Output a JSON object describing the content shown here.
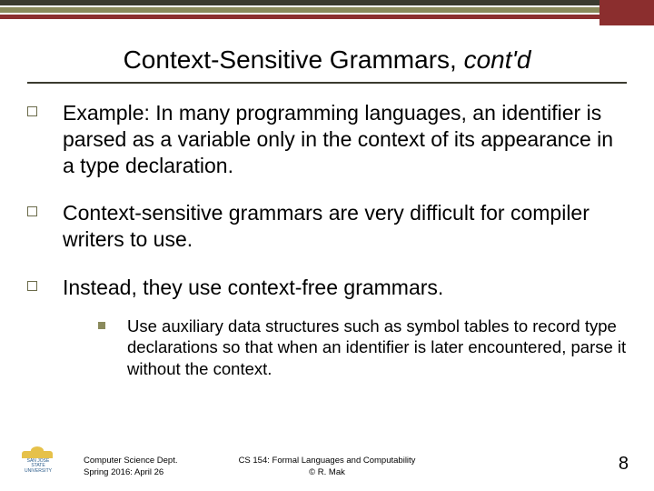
{
  "title": {
    "main": "Context-Sensitive Grammars, ",
    "emph": "cont'd"
  },
  "bullets": [
    {
      "text": "Example: In many programming languages, an identifier is parsed as a variable only in the context of its appearance in a type declaration."
    },
    {
      "text": "Context-sensitive grammars are very difficult for compiler writers to use."
    },
    {
      "text": "Instead, they use context-free grammars.",
      "sub": [
        {
          "text": "Use auxiliary data structures such as symbol tables to record type declarations so that when an identifier is later encountered, parse it without the context."
        }
      ]
    }
  ],
  "footer": {
    "left_line1": "Computer Science Dept.",
    "left_line2": "Spring 2016: April 26",
    "center_line1": "CS 154: Formal Languages and Computability",
    "center_line2": "© R. Mak",
    "logo_text1": "SAN JOSE STATE",
    "logo_text2": "UNIVERSITY"
  },
  "page_number": "8"
}
